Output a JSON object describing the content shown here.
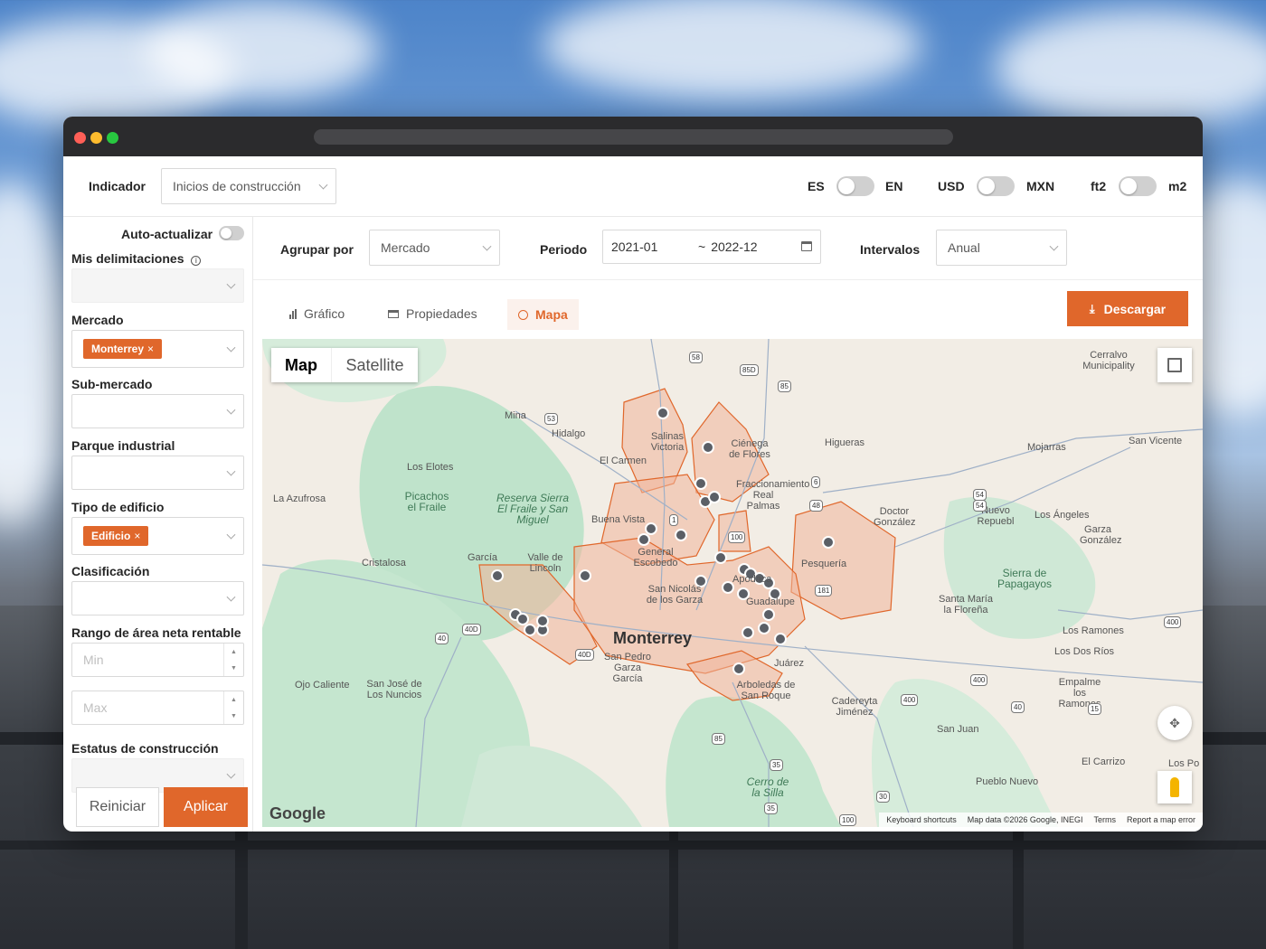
{
  "indicator": {
    "label": "Indicador",
    "value": "Inicios de construcción"
  },
  "units": {
    "lang_left": "ES",
    "lang_right": "EN",
    "cur_left": "USD",
    "cur_right": "MXN",
    "area_left": "ft2",
    "area_right": "m2"
  },
  "sidebar": {
    "auto_update": "Auto-actualizar",
    "my_delimitations": "Mis delimitaciones",
    "market_label": "Mercado",
    "market_tag": "Monterrey",
    "submarket_label": "Sub-mercado",
    "park_label": "Parque industrial",
    "building_type_label": "Tipo de edificio",
    "building_type_tag": "Edificio",
    "classification_label": "Clasificación",
    "area_range_label": "Rango de área neta rentable",
    "min_placeholder": "Min",
    "max_placeholder": "Max",
    "construction_status_label": "Estatus de construcción",
    "reset_label": "Reiniciar",
    "apply_label": "Aplicar"
  },
  "filters": {
    "group_by_label": "Agrupar por",
    "group_by_value": "Mercado",
    "period_label": "Periodo",
    "period_start": "2021-01",
    "period_sep": "~",
    "period_end": "2022-12",
    "interval_label": "Intervalos",
    "interval_value": "Anual"
  },
  "tabs": {
    "chart": "Gráfico",
    "properties": "Propiedades",
    "map": "Mapa",
    "active": "map"
  },
  "download_label": "Descargar",
  "map": {
    "type_map": "Map",
    "type_satellite": "Satellite",
    "attribution": [
      "Keyboard shortcuts",
      "Map data ©2026 Google, INEGI",
      "Terms",
      "Report a map error"
    ],
    "places": [
      "Monterrey",
      "San Pedro Garza García",
      "San Nicolás de los Garza",
      "General Escobedo",
      "Apodaca",
      "Guadalupe",
      "Juárez",
      "Pesquería",
      "Salinas Victoria",
      "Ciénega de Flores",
      "Fraccionamiento Real Palmas",
      "Hidalgo",
      "Mina",
      "El Carmen",
      "Los Elotes",
      "La Azufrosa",
      "García",
      "Valle de Lincoln",
      "Cristalosa",
      "Buena Vista",
      "Higueras",
      "Mojarras",
      "San Vicente",
      "Cerralvo Municipality",
      "Doctor González",
      "Nuevo Repuebl",
      "Los Ángeles",
      "Garza González",
      "Santa María la Floreña",
      "Los Ramones",
      "Los Dos Ríos",
      "Empalme los Ramones",
      "Cadereyta Jiménez",
      "San Juan",
      "El Carrizo",
      "Pueblo Nuevo",
      "Arboledas de San Roque",
      "Ojo Caliente",
      "San José de Los Nuncios",
      "Los Po",
      "Picachos el Fraile",
      "Reserva Sierra El Fraile y San Miguel",
      "Sierra de Papagayos",
      "Cerro de la Silla"
    ],
    "highways": [
      "58",
      "85D",
      "85",
      "53",
      "6",
      "48",
      "54",
      "54",
      "1",
      "100",
      "181",
      "40D",
      "40",
      "40D",
      "400",
      "400",
      "40",
      "15",
      "85",
      "35",
      "35",
      "30",
      "100",
      "400"
    ]
  }
}
